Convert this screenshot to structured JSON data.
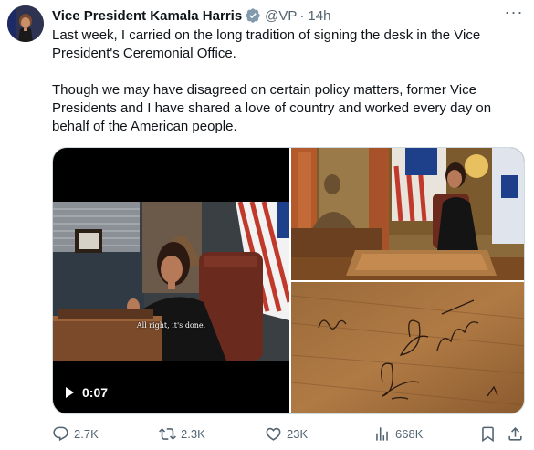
{
  "tweet": {
    "author_name": "Vice President Kamala Harris",
    "handle": "@VP",
    "separator": "·",
    "time": "14h",
    "more_label": "···",
    "paragraph_1": "Last week, I carried on the long tradition of signing the desk in the Vice President's Ceremonial Office.",
    "paragraph_2": "Though we may have disagreed on certain policy matters, former Vice Presidents and I have shared a love of country and worked every day on behalf of the American people."
  },
  "media": {
    "video_caption": "All right, it's done.",
    "video_duration": "0:07"
  },
  "actions": {
    "replies": "2.7K",
    "reposts": "2.3K",
    "likes": "23K",
    "views": "668K"
  },
  "colors": {
    "text_primary": "#0f1419",
    "text_secondary": "#536471",
    "verified_gray": "#829aab"
  }
}
